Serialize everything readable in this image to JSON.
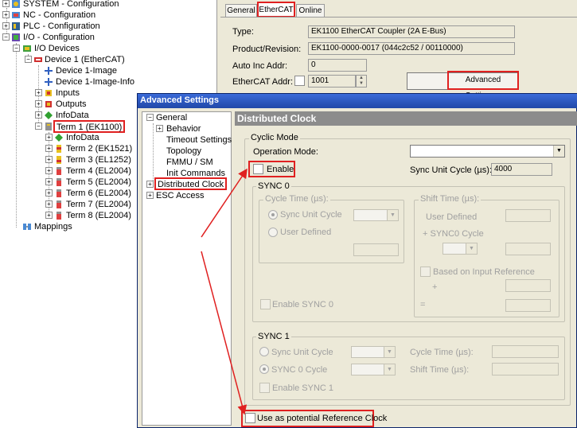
{
  "tree": {
    "nodes": [
      {
        "label": "SYSTEM - Configuration"
      },
      {
        "label": "NC - Configuration"
      },
      {
        "label": "PLC - Configuration"
      },
      {
        "label": "I/O - Configuration"
      },
      {
        "label": "I/O Devices"
      },
      {
        "label": "Device 1 (EtherCAT)"
      },
      {
        "label": "Device 1-Image"
      },
      {
        "label": "Device 1-Image-Info"
      },
      {
        "label": "Inputs"
      },
      {
        "label": "Outputs"
      },
      {
        "label": "InfoData"
      },
      {
        "label": "Term 1 (EK1100)"
      },
      {
        "label": "InfoData"
      },
      {
        "label": "Term 2 (EK1521)"
      },
      {
        "label": "Term 3 (EL1252)"
      },
      {
        "label": "Term 4 (EL2004)"
      },
      {
        "label": "Term 5 (EL2004)"
      },
      {
        "label": "Term 6 (EL2004)"
      },
      {
        "label": "Term 7 (EL2004)"
      },
      {
        "label": "Term 8 (EL2004)"
      },
      {
        "label": "Mappings"
      }
    ]
  },
  "props": {
    "tabs": [
      "General",
      "EtherCAT",
      "Online"
    ],
    "type_label": "Type:",
    "type_value": "EK1100 EtherCAT Coupler (2A E-Bus)",
    "product_label": "Product/Revision:",
    "product_value": "EK1100-0000-0017 (044c2c52 / 00110000)",
    "autoinc_label": "Auto Inc Addr:",
    "autoinc_value": "0",
    "ecaddr_label": "EtherCAT Addr:",
    "ecaddr_value": "1001",
    "adv_button": "Advanced Settings..."
  },
  "dialog": {
    "title": "Advanced Settings",
    "nav": [
      {
        "label": "General"
      },
      {
        "label": "Behavior"
      },
      {
        "label": "Timeout Settings"
      },
      {
        "label": "Topology"
      },
      {
        "label": "FMMU / SM"
      },
      {
        "label": "Init Commands"
      },
      {
        "label": "Distributed Clock"
      },
      {
        "label": "ESC Access"
      }
    ],
    "panel_title": "Distributed Clock",
    "cyclic_mode": "Cyclic Mode",
    "operation_mode": "Operation Mode:",
    "operation_mode_value": "",
    "enable": "Enable",
    "sync_unit_cycle_label": "Sync Unit Cycle (µs):",
    "sync_unit_cycle_value": "4000",
    "sync0": {
      "title": "SYNC 0",
      "cycle_time": "Cycle Time (µs):",
      "sync_unit_cycle": "Sync Unit Cycle",
      "user_defined": "User Defined",
      "shift_time": "Shift Time (µs):",
      "shift_user_defined": "User Defined",
      "plus_sync0": "+ SYNC0 Cycle",
      "based_on_input": "Based on Input Reference",
      "plus": "+",
      "equals": "=",
      "enable_sync0": "Enable SYNC 0"
    },
    "sync1": {
      "title": "SYNC 1",
      "sync_unit_cycle": "Sync Unit Cycle",
      "sync0_cycle": "SYNC 0 Cycle",
      "cycle_time": "Cycle Time (µs):",
      "shift_time": "Shift Time (µs):",
      "enable_sync1": "Enable SYNC 1"
    },
    "use_ref_clock": "Use as potential Reference Clock"
  },
  "colors": {
    "highlight": "#e02020",
    "title_bar": "#2b56c4",
    "panel": "#ece9d8"
  }
}
